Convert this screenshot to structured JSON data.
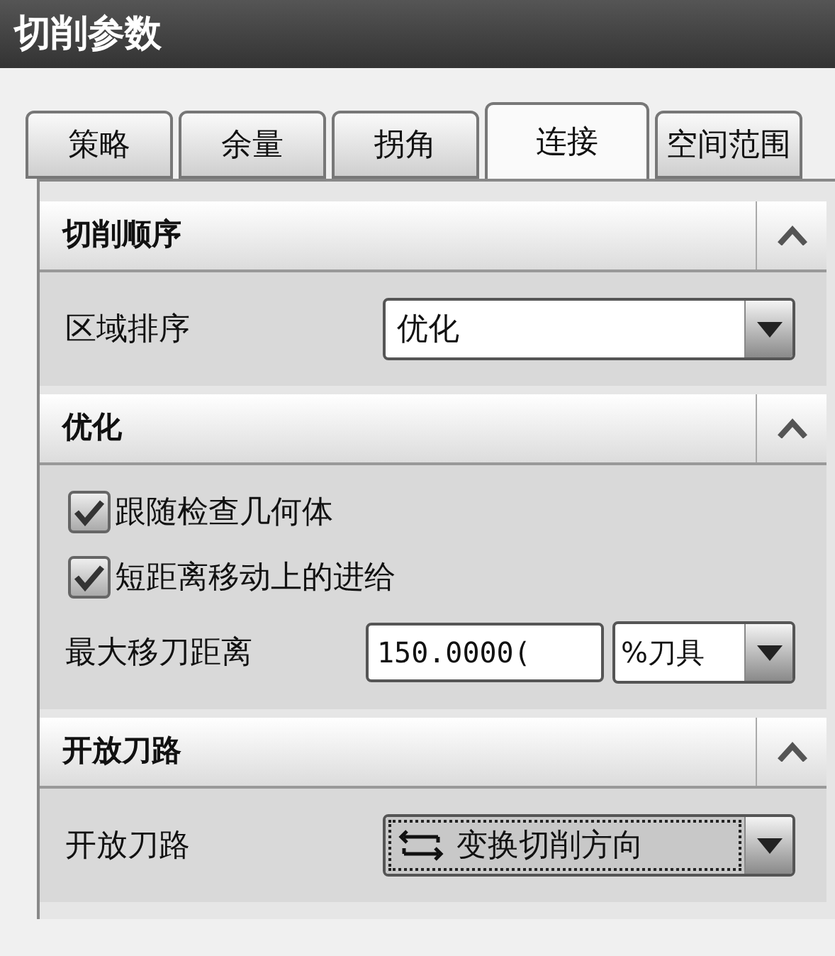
{
  "window": {
    "title": "切削参数"
  },
  "tabs": [
    {
      "label": "策略",
      "selected": false
    },
    {
      "label": "余量",
      "selected": false
    },
    {
      "label": "拐角",
      "selected": false
    },
    {
      "label": "连接",
      "selected": true
    },
    {
      "label": "空间范围",
      "selected": false
    }
  ],
  "sections": [
    {
      "title": "切削顺序",
      "expanded": true,
      "rows": [
        {
          "kind": "select",
          "label": "区域排序",
          "value": "优化",
          "focused": false,
          "icon": false
        }
      ]
    },
    {
      "title": "优化",
      "expanded": true,
      "rows": [
        {
          "kind": "checkbox",
          "label": "跟随检查几何体",
          "checked": true
        },
        {
          "kind": "checkbox",
          "label": "短距离移动上的进给",
          "checked": true
        },
        {
          "kind": "number",
          "label": "最大移刀距离",
          "value": "150.0000(",
          "unit": "%刀具"
        }
      ]
    },
    {
      "title": "开放刀路",
      "expanded": true,
      "rows": [
        {
          "kind": "select",
          "label": "开放刀路",
          "value": "变换切削方向",
          "focused": true,
          "icon": true
        }
      ]
    }
  ]
}
